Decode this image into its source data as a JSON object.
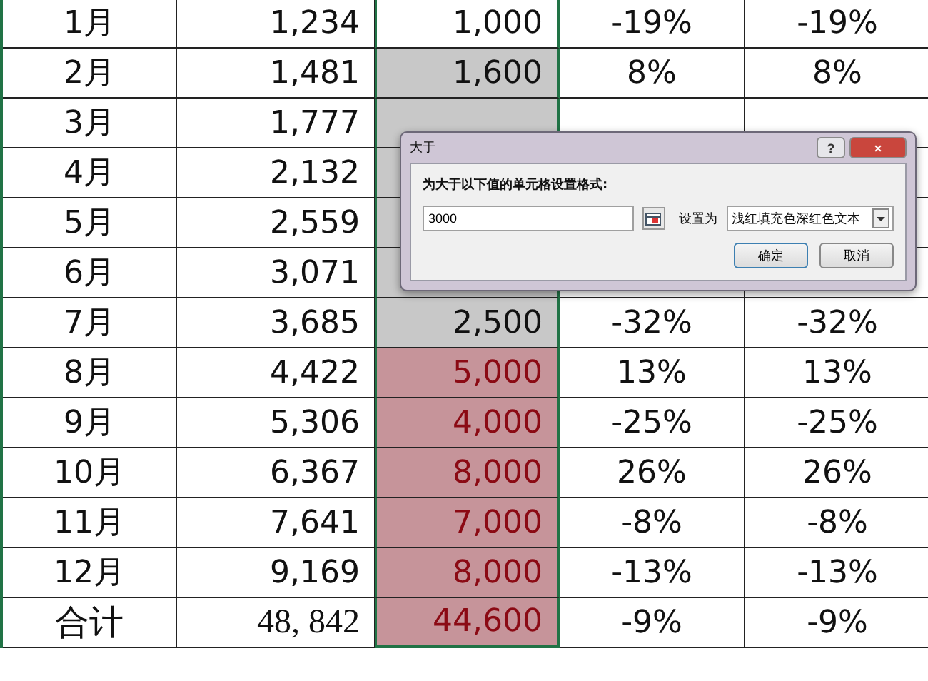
{
  "table": {
    "rows": [
      {
        "kind": "month",
        "month": "1月",
        "sales": "1,234",
        "target": {
          "text": "1,000"
        },
        "pct_1": "-19%",
        "pct_2": "-19%"
      },
      {
        "kind": "month",
        "month": "2月",
        "sales": "1,481",
        "target": {
          "text": "1,600",
          "color": "#c8c8c8"
        },
        "pct_1": "8%",
        "pct_2": "8%"
      },
      {
        "kind": "month",
        "month": "3月",
        "sales": "1,777",
        "target": {
          "color": "#c8c8c8"
        }
      },
      {
        "kind": "month",
        "month": "4月",
        "sales": "2,132",
        "target": {
          "color": "#c8c8c8"
        }
      },
      {
        "kind": "month",
        "month": "5月",
        "sales": "2,559",
        "target": {
          "color": "#c8c8c8"
        }
      },
      {
        "kind": "month",
        "month": "6月",
        "sales": "3,071",
        "target": {
          "color": "#c8c8c8"
        }
      },
      {
        "kind": "month",
        "month": "7月",
        "sales": "3,685",
        "target": {
          "text": "2,500",
          "color": "#c8c8c8"
        },
        "pct_1": "-32%",
        "pct_2": "-32%"
      },
      {
        "kind": "month",
        "month": "8月",
        "sales": "4,422",
        "target": {
          "text": "5,000",
          "color": "#c6949a"
        },
        "pct_1": "13%",
        "pct_2": "13%"
      },
      {
        "kind": "month",
        "month": "9月",
        "sales": "5,306",
        "target": {
          "text": "4,000",
          "color": "#c6949a"
        },
        "pct_1": "-25%",
        "pct_2": "-25%"
      },
      {
        "kind": "month",
        "month": "10月",
        "sales": "6,367",
        "target": {
          "text": "8,000",
          "color": "#c6949a"
        },
        "pct_1": "26%",
        "pct_2": "26%"
      },
      {
        "kind": "month",
        "month": "11月",
        "sales": "7,641",
        "target": {
          "text": "7,000",
          "color": "#c6949a"
        },
        "pct_1": "-8%",
        "pct_2": "-8%"
      },
      {
        "kind": "month",
        "month": "12月",
        "sales": "9,169",
        "target": {
          "text": "8,000",
          "color": "#c6949a"
        },
        "pct_1": "-13%",
        "pct_2": "-13%"
      },
      {
        "kind": "total",
        "month": "合计",
        "sales": "48, 842",
        "target": {
          "text": "44,600",
          "color": "#c6949a"
        },
        "pct_1": "-9%",
        "pct_2": "-9%"
      }
    ]
  },
  "dialog": {
    "title": "大于",
    "help": "?",
    "close": "×",
    "prompt": "为大于以下值的单元格设置格式:",
    "value": "3000",
    "format_label": "设置为",
    "format": "浅红填充色深红色文本",
    "buttons": [
      "确定",
      "取消"
    ]
  }
}
